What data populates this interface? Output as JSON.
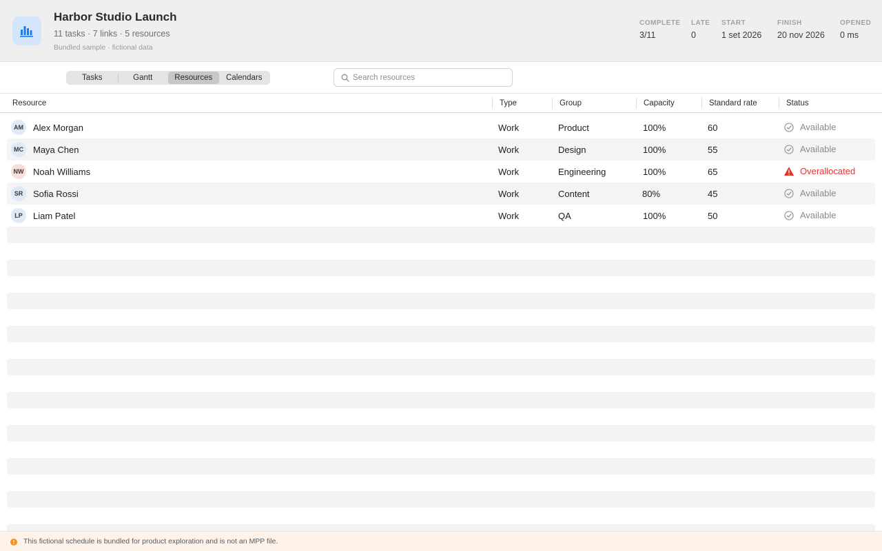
{
  "header": {
    "title": "Harbor Studio Launch",
    "subtitle": "11 tasks · 7 links · 5 resources",
    "note": "Bundled sample · fictional data",
    "icon": "bar-chart-icon",
    "accent": "#1a7cf0",
    "stats": [
      {
        "label": "COMPLETE",
        "value": "3/11"
      },
      {
        "label": "LATE",
        "value": "0"
      },
      {
        "label": "START",
        "value": "1 set 2026"
      },
      {
        "label": "FINISH",
        "value": "20 nov 2026"
      },
      {
        "label": "OPENED",
        "value": "0 ms"
      }
    ]
  },
  "tabs": [
    {
      "label": "Tasks",
      "active": false
    },
    {
      "label": "Gantt",
      "active": false
    },
    {
      "label": "Resources",
      "active": true
    },
    {
      "label": "Calendars",
      "active": false
    }
  ],
  "search": {
    "placeholder": "Search resources",
    "value": ""
  },
  "table": {
    "columns": [
      "Resource",
      "Type",
      "Group",
      "Capacity",
      "Standard rate",
      "Status"
    ],
    "rows": [
      {
        "initials": "AM",
        "name": "Alex Morgan",
        "type": "Work",
        "group": "Product",
        "capacity": "100%",
        "rate": "60",
        "status": "Available",
        "status_icon": "check-circle-icon"
      },
      {
        "initials": "MC",
        "name": "Maya Chen",
        "type": "Work",
        "group": "Design",
        "capacity": "100%",
        "rate": "55",
        "status": "Available",
        "status_icon": "check-circle-icon"
      },
      {
        "initials": "NW",
        "name": "Noah Williams",
        "type": "Work",
        "group": "Engineering",
        "capacity": "100%",
        "rate": "65",
        "status": "Overallocated",
        "status_icon": "warning-triangle-icon"
      },
      {
        "initials": "SR",
        "name": "Sofia Rossi",
        "type": "Work",
        "group": "Content",
        "capacity": "80%",
        "rate": "45",
        "status": "Available",
        "status_icon": "check-circle-icon"
      },
      {
        "initials": "LP",
        "name": "Liam Patel",
        "type": "Work",
        "group": "QA",
        "capacity": "100%",
        "rate": "50",
        "status": "Available",
        "status_icon": "check-circle-icon"
      }
    ]
  },
  "footer": {
    "text": "This fictional schedule is bundled for product exploration and is not an MPP file.",
    "icon": "info-circle-icon",
    "color": "#f0931b"
  },
  "colors": {
    "alert": "#e5342f",
    "available": "#8a8a8e"
  }
}
